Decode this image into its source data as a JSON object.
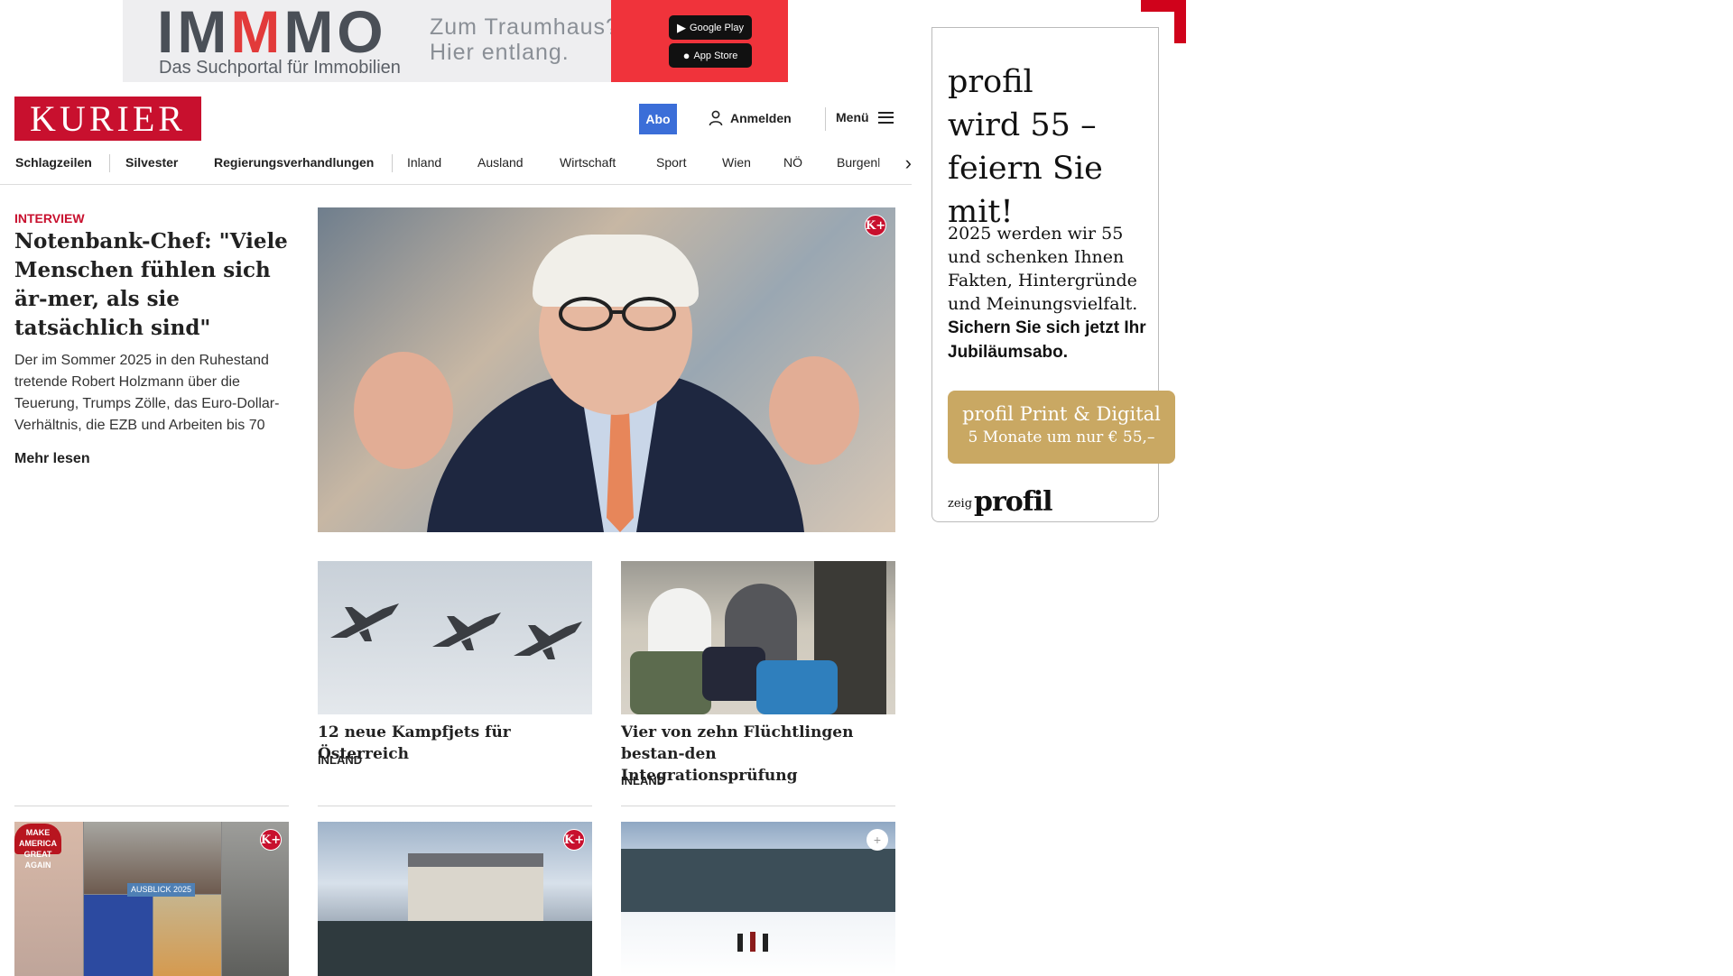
{
  "ad_top": {
    "logo_pre": "IM",
    "logo_m": "M",
    "logo_post": "MO",
    "tagline": "Das Suchportal für Immobilien",
    "slogan_line1": "Zum Traumhaus?",
    "slogan_line2": "Hier entlang.",
    "google_play": "Google Play",
    "app_store": "App Store",
    "accent_color": "#f0333b"
  },
  "header": {
    "brand": "KURIER",
    "abo": "Abo",
    "login": "Anmelden",
    "menu": "Menü",
    "brand_color": "#c8102e"
  },
  "nav": {
    "items": [
      "Schlagzeilen",
      "Silvester",
      "Regierungsverhandlungen",
      "Inland",
      "Ausland",
      "Wirtschaft",
      "Sport",
      "Wien",
      "NÖ",
      "Burgenl"
    ]
  },
  "lead": {
    "kicker": "INTERVIEW",
    "headline": "Notenbank-Chef: \"Viele Menschen fühlen sich är-mer, als sie tatsächlich sind\"",
    "teaser": "Der im Sommer 2025 in den Ruhestand tretende Robert Holzmann über die Teuerung, Trumps Zölle, das Euro-Dollar-Verhältnis, die EZB und Arbeiten bis 70",
    "more": "Mehr lesen",
    "badge": "K+"
  },
  "teasers": [
    {
      "headline": "12 neue Kampfjets für Österreich",
      "category": "INLAND"
    },
    {
      "headline": "Vier von zehn Flüchtlingen bestan-den Integrationsprüfung",
      "category": "INLAND"
    }
  ],
  "row2": {
    "collage_cap": "MAKE AMERICA GREAT AGAIN",
    "collage_badge": "AUSBLICK 2025",
    "badge": "K+"
  },
  "ad_right": {
    "big_line1": "profil",
    "big_line2": "wird 55 –",
    "big_line3": "feiern Sie mit!",
    "copy": "2025 werden wir 55 und schenken Ihnen Fakten, Hintergründe und Meinungsvielfalt.",
    "copy_bold": "Sichern Sie sich jetzt Ihr Jubiläumsabo.",
    "cta_line1": "profil Print & Digital",
    "cta_line2": "5 Monate um nur € 55,–",
    "zeig": "zeig",
    "logo": "profil",
    "cta_color": "#c9a863"
  }
}
